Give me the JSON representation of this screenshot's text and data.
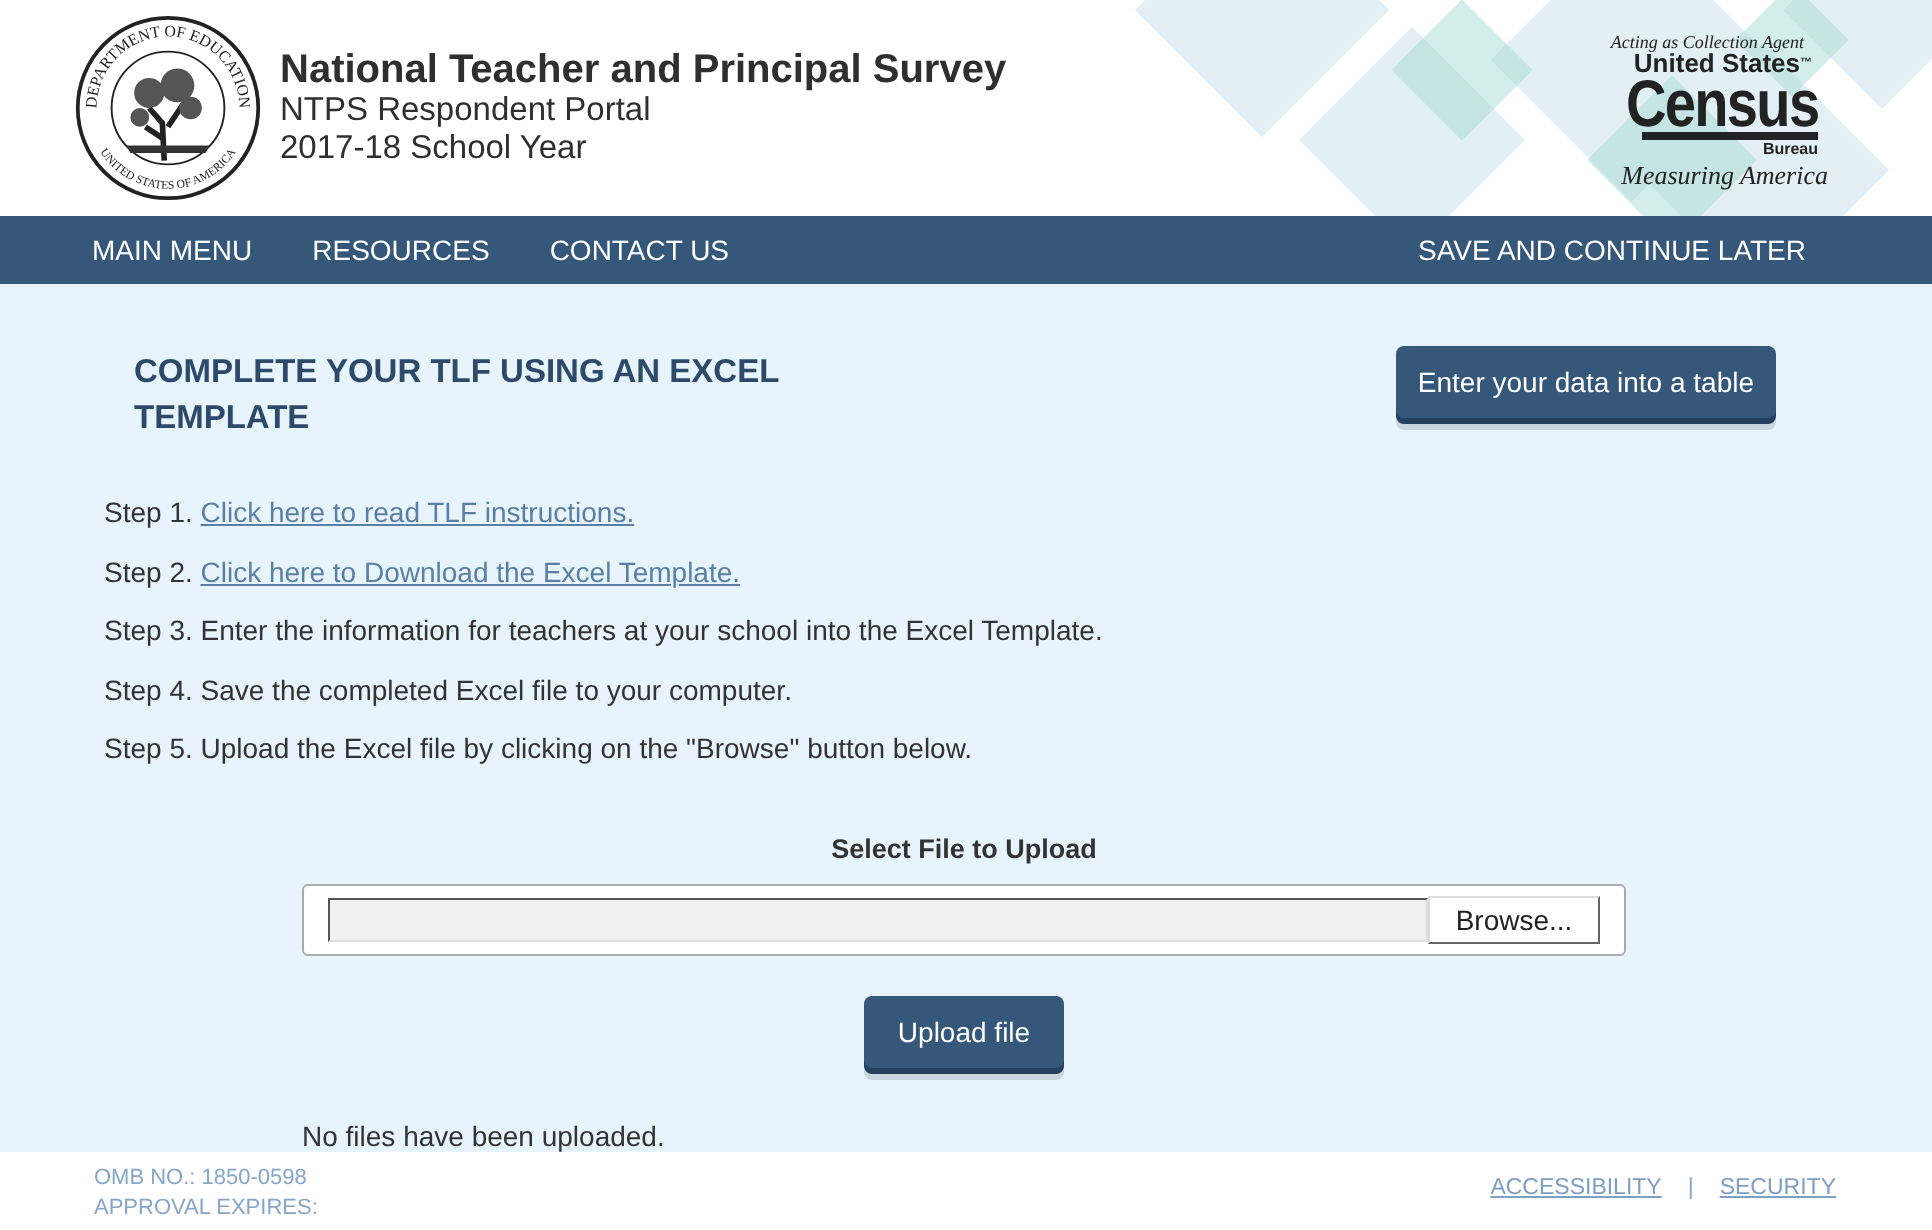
{
  "header": {
    "seal": {
      "top_text": "DEPARTMENT OF EDUCATION",
      "bottom_text": "UNITED STATES OF AMERICA"
    },
    "title": "National Teacher and Principal Survey",
    "subtitle": "NTPS Respondent Portal",
    "year": "2017-18 School Year",
    "census": {
      "agent": "Acting as Collection Agent",
      "line1": "United States",
      "tm": "™",
      "line2": "Census",
      "line3": "Bureau",
      "tagline": "Measuring America"
    }
  },
  "nav": {
    "items": [
      "MAIN MENU",
      "RESOURCES",
      "CONTACT US"
    ],
    "right": "SAVE AND CONTINUE LATER"
  },
  "main": {
    "heading": "COMPLETE YOUR TLF USING AN EXCEL TEMPLATE",
    "table_button": "Enter your data into a table",
    "steps": [
      {
        "label": "Step 1.",
        "text": "Click here to read TLF instructions.",
        "kind": "link"
      },
      {
        "label": "Step 2.",
        "text": "Click here to Download the Excel Template.",
        "kind": "link"
      },
      {
        "label": "Step 3.",
        "text": "Enter the information for teachers at your school into the Excel Template.",
        "kind": "text"
      },
      {
        "label": "Step 4.",
        "text": "Save the completed Excel file to your computer.",
        "kind": "text"
      },
      {
        "label": "Step 5.",
        "text": "Upload the Excel file by clicking on the \"Browse\" button below.",
        "kind": "text"
      }
    ],
    "upload": {
      "label": "Select File to Upload",
      "browse": "Browse...",
      "button": "Upload file",
      "status": "No files have been uploaded."
    }
  },
  "footer": {
    "omb": "OMB NO.: 1850-0598",
    "expires": "APPROVAL EXPIRES:",
    "links": [
      "ACCESSIBILITY",
      "SECURITY"
    ],
    "separator": "|"
  }
}
